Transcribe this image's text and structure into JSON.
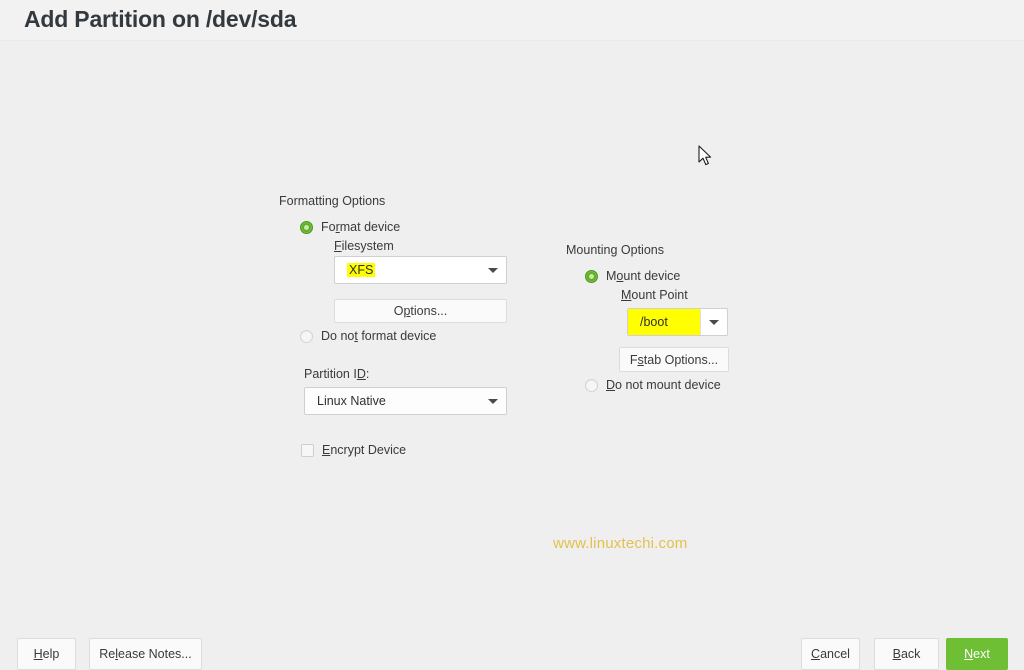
{
  "header": {
    "title": "Add Partition on /dev/sda"
  },
  "formatting": {
    "group_label": "Formatting Options",
    "format_device": {
      "label": "Format device",
      "label_pre": "Fo",
      "label_accel": "r",
      "label_post": "mat device",
      "selected": true
    },
    "filesystem_label": "Filesystem",
    "filesystem_label_accel": "F",
    "filesystem_label_post": "ilesystem",
    "filesystem_value": "XFS",
    "options_button": "Options...",
    "options_button_pre": "O",
    "options_button_accel": "p",
    "options_button_post": "tions...",
    "do_not_format": {
      "label": "Do not format device",
      "label_pre": "Do no",
      "label_accel": "t",
      "label_post": " format device",
      "selected": false
    },
    "partition_id_label": "Partition ID:",
    "partition_id_label_pre": "Partition I",
    "partition_id_label_accel": "D",
    "partition_id_label_post": ":",
    "partition_id_value": "Linux Native",
    "encrypt_device": {
      "label": "Encrypt Device",
      "label_accel": "E",
      "label_post": "ncrypt Device",
      "checked": false
    }
  },
  "mounting": {
    "group_label": "Mounting Options",
    "mount_device": {
      "label": "Mount device",
      "label_pre": "M",
      "label_accel": "o",
      "label_post": "unt device",
      "selected": true
    },
    "mount_point_label": "Mount Point",
    "mount_point_label_accel": "M",
    "mount_point_label_post": "ount Point",
    "mount_point_value": "/boot",
    "fstab_button": "Fstab Options...",
    "fstab_button_pre": "F",
    "fstab_button_accel": "s",
    "fstab_button_post": "tab Options...",
    "do_not_mount": {
      "label": "Do not mount device",
      "label_accel": "D",
      "label_post": "o not mount device",
      "selected": false
    }
  },
  "watermark": "www.linuxtechi.com",
  "footer": {
    "help": "Help",
    "help_accel": "H",
    "help_post": "elp",
    "release_notes": "Release Notes...",
    "release_notes_pre": "Re",
    "release_notes_accel": "l",
    "release_notes_post": "ease Notes...",
    "cancel": "Cancel",
    "cancel_accel": "C",
    "cancel_post": "ancel",
    "back": "Back",
    "back_accel": "B",
    "back_post": "ack",
    "next": "Next",
    "next_accel": "N",
    "next_post": "ext"
  },
  "colors": {
    "accent_green": "#6fbf35",
    "radio_green": "#5fae28",
    "highlight_yellow": "#ffff00",
    "watermark_gold": "#e3c14e",
    "background": "#efefef"
  }
}
